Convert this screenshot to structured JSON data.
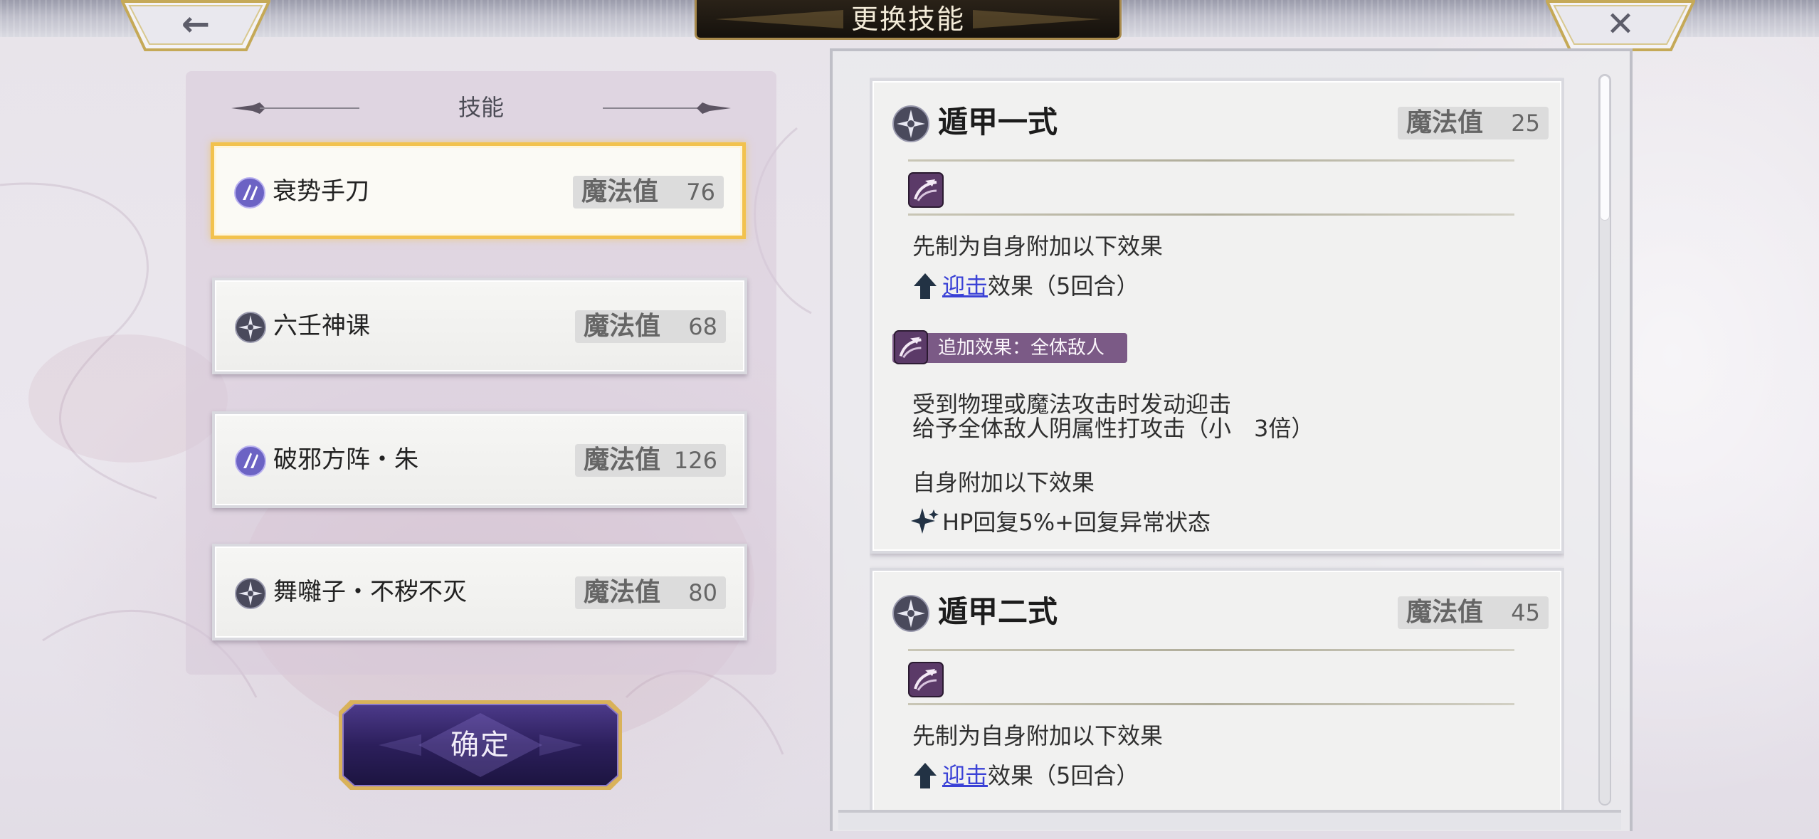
{
  "header": {
    "title": "更换技能",
    "back_icon": "←",
    "close_icon": "✕"
  },
  "left_panel": {
    "section_label": "技能",
    "skills": [
      {
        "name": "衰势手刀",
        "mana_label": "魔法值",
        "mana": "76",
        "icon": "slash-icon",
        "selected": true
      },
      {
        "name": "六壬神课",
        "mana_label": "魔法值",
        "mana": "68",
        "icon": "shuriken-icon",
        "selected": false
      },
      {
        "name": "破邪方阵・朱",
        "mana_label": "魔法值",
        "mana": "126",
        "icon": "slash-icon",
        "selected": false
      },
      {
        "name": "舞囃子・不秽不灭",
        "mana_label": "魔法值",
        "mana": "80",
        "icon": "shuriken-icon",
        "selected": false
      }
    ],
    "confirm_label": "确定"
  },
  "details": [
    {
      "name": "遁甲一式",
      "mana_label": "魔法值",
      "mana": "25",
      "pre_text": "先制为自身附加以下效果",
      "effect_link": "迎击",
      "effect_suffix": "效果（5回合）",
      "extra_tag": "追加效果：全体敌人",
      "desc_line1": "受到物理或魔法攻击时发动迎击",
      "desc_line2": "给予全体敌人阴属性打攻击（小　3倍）",
      "self_text": "自身附加以下效果",
      "heal_text": "HP回复5%+回复异常状态"
    },
    {
      "name": "遁甲二式",
      "mana_label": "魔法值",
      "mana": "45",
      "pre_text": "先制为自身附加以下效果",
      "effect_link": "迎击",
      "effect_suffix": "效果（5回合）"
    }
  ],
  "colors": {
    "selected_border": "#f2c24e",
    "tag_bg": "#7b5a86",
    "link": "#3a41d6",
    "confirm_bg": "#3b2a6e"
  },
  "scrollbar": {
    "position": 0.0
  }
}
